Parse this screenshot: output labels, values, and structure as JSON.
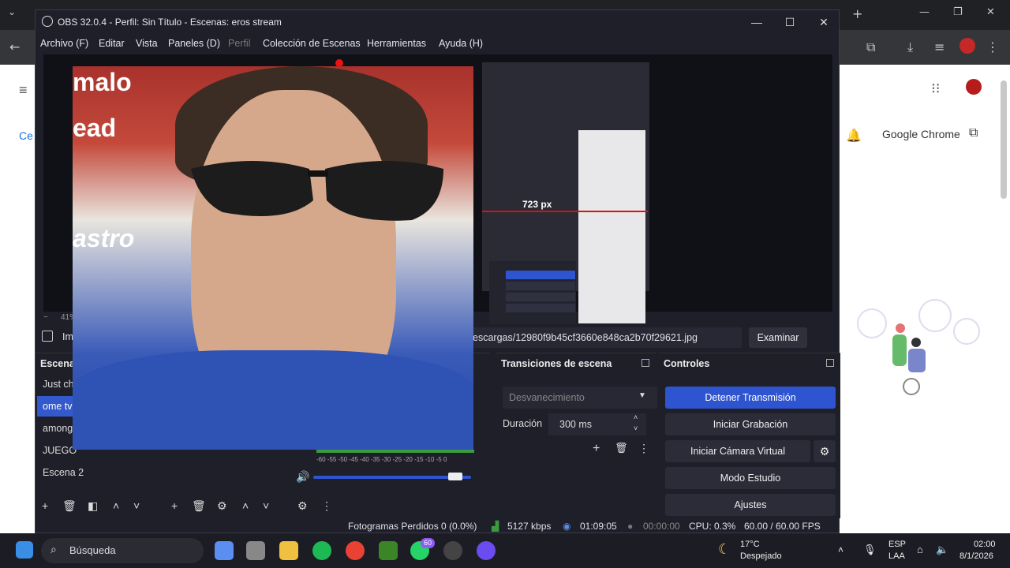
{
  "obs": {
    "window_title": "OBS 32.0.4 - Perfil: Sin Título - Escenas: eros stream",
    "menu": [
      "Archivo (F)",
      "Editar",
      "Vista",
      "Paneles (D)",
      "Perfil",
      "Colección de Escenas",
      "Herramientas",
      "Ayuda (H)"
    ],
    "preview": {
      "measure_label": "723 px",
      "zoom_label": "41%",
      "minus": "−"
    },
    "source": {
      "name_prefix": "Im",
      "path": "escargas/12980f9b45cf3660e848ca2b70f29621.jpg",
      "browse_label": "Examinar"
    },
    "scenes": {
      "title": "Escena",
      "items": [
        "Just ch",
        "ome tv",
        "among",
        "JUEGO",
        "Escena 2"
      ],
      "selected_index": 1
    },
    "audio": {
      "scale": "-60 -55 -50 -45 -40 -35 -30 -25 -20 -15 -10 -5 0",
      "volume_fraction": 0.9
    },
    "transitions": {
      "title": "Transiciones de escena",
      "selected": "Desvanecimiento",
      "duration_label": "Duración",
      "duration_value": "300 ms"
    },
    "controls": {
      "title": "Controles",
      "stop_stream": "Detener Transmisión",
      "start_recording": "Iniciar Grabación",
      "start_virtual_cam": "Iniciar Cámara Virtual",
      "studio_mode": "Modo Estudio",
      "settings": "Ajustes"
    },
    "status": {
      "dropped_frames": "Fotogramas Perdidos 0 (0.0%)",
      "bitrate": "5127 kbps",
      "stream_time": "01:09:05",
      "rec_time": "00:00:00",
      "cpu": "CPU: 0.3%",
      "fps": "60.00 / 60.00 FPS"
    }
  },
  "chrome": {
    "open_label": "Google Chrome",
    "left_fragment": "Ce"
  },
  "taskbar": {
    "search_placeholder": "Búsqueda",
    "whatsapp_badge": "60",
    "weather_temp": "17°C",
    "weather_desc": "Despejado",
    "lang_1": "ESP",
    "lang_2": "LAA",
    "time": "02:00",
    "date": "8/1/2026"
  },
  "colors": {
    "obs_bg": "#1e1f29",
    "accent": "#2e54d0",
    "selection": "#3459cc"
  }
}
